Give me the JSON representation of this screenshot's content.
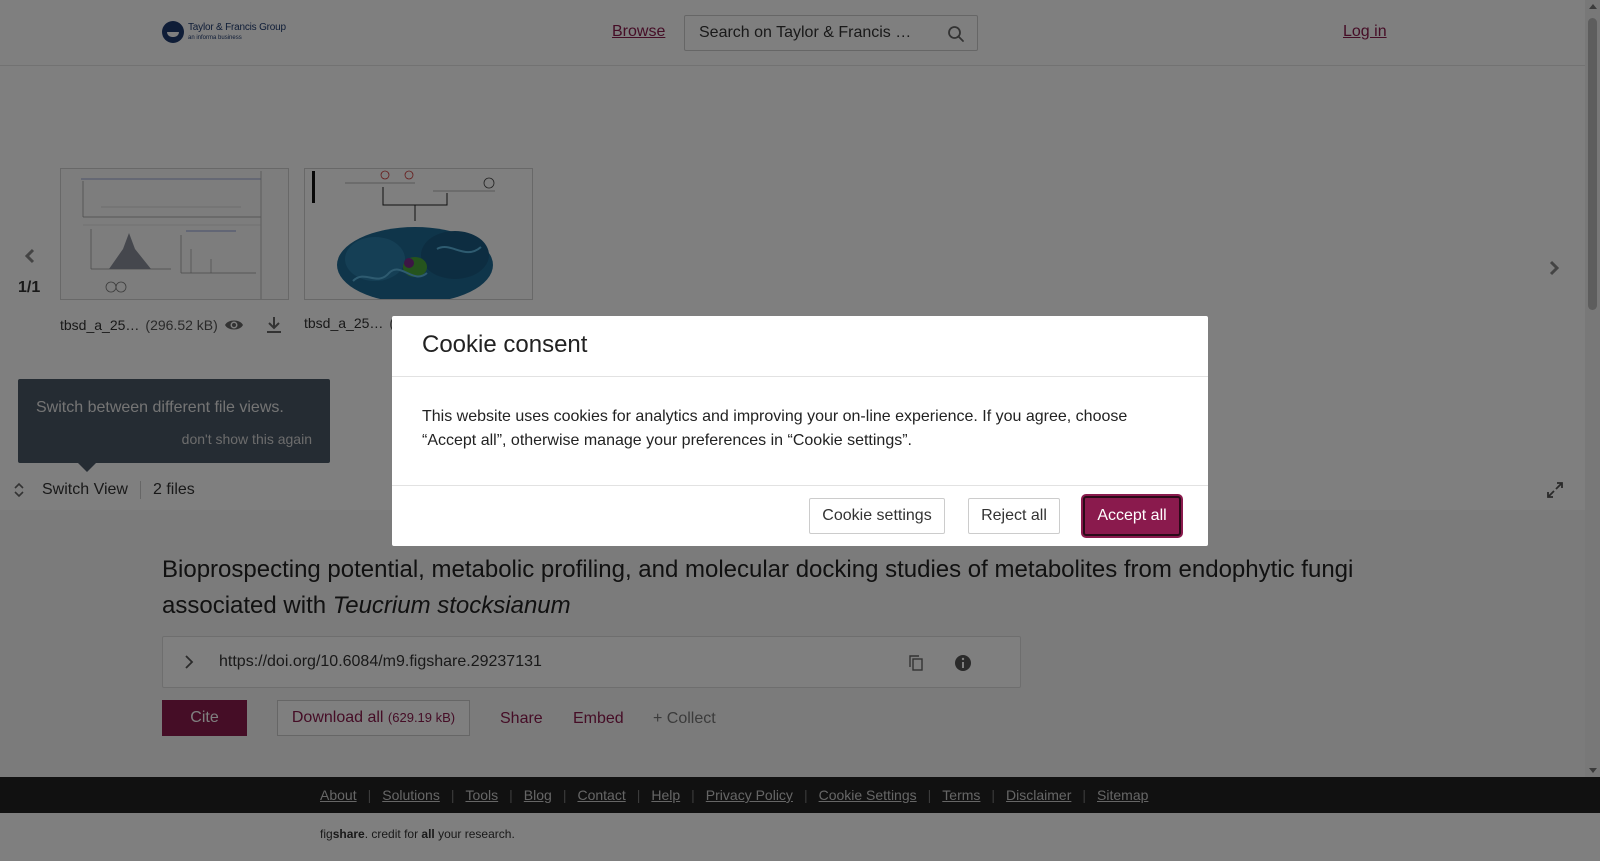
{
  "header": {
    "logo_main": "Taylor & Francis Group",
    "logo_sub": "an informa business",
    "browse_label": "Browse",
    "search_value": "Search on Taylor & Francis …",
    "login_label": "Log in"
  },
  "viewer": {
    "page_counter": "1/1",
    "files": [
      {
        "name": "tbsd_a_25…",
        "size": "(296.52 kB)"
      },
      {
        "name": "tbsd_a_25…",
        "size": "("
      }
    ],
    "tooltip_text": "Switch between different file views.",
    "tooltip_dismiss": "don't show this again",
    "switch_view_label": "Switch View",
    "files_count": "2 files"
  },
  "article": {
    "title_main": "Bioprospecting potential, metabolic profiling, and molecular docking studies of metabolites from endophytic fungi associated with ",
    "title_italic": "Teucrium stocksianum",
    "doi": "https://doi.org/10.6084/m9.figshare.29237131",
    "cite_label": "Cite",
    "download_label": "Download all",
    "download_size": "(629.19 kB)",
    "share_label": "Share",
    "embed_label": "Embed",
    "collect_label": "+ Collect"
  },
  "footer": {
    "links": [
      "About",
      "Solutions",
      "Tools",
      "Blog",
      "Contact",
      "Help",
      "Privacy Policy",
      "Cookie Settings",
      "Terms",
      "Disclaimer",
      "Sitemap"
    ],
    "tagline_fig": "fig",
    "tagline_share": "share",
    "tagline_mid": ". credit for ",
    "tagline_all": "all",
    "tagline_end": " your research."
  },
  "cookie_modal": {
    "title": "Cookie consent",
    "body": "This website uses cookies for analytics and improving your on-line experience. If you agree, choose “Accept all”, otherwise manage your preferences in “Cookie settings”.",
    "settings_label": "Cookie settings",
    "reject_label": "Reject all",
    "accept_label": "Accept all"
  },
  "colors": {
    "brand": "#8a1a4d",
    "logo_blue": "#1f3a6e",
    "footer_bg": "#222222"
  }
}
